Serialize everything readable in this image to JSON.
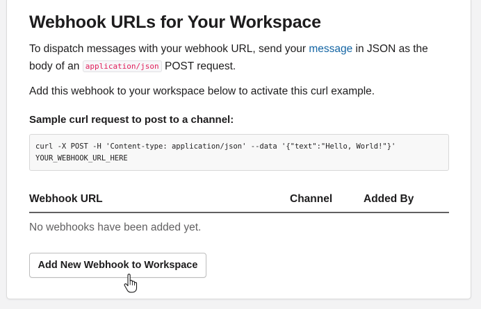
{
  "page": {
    "title": "Webhook URLs for Your Workspace",
    "intro": {
      "text_before_link": "To dispatch messages with your webhook URL, send your ",
      "link_text": "message",
      "text_after_link": " in JSON as the body of an ",
      "inline_code": "application/json",
      "text_end": " POST request."
    },
    "activate_note": "Add this webhook to your workspace below to activate this curl example.",
    "sample_label": "Sample curl request to post to a channel:",
    "sample_code": "curl -X POST -H 'Content-type: application/json' --data '{\"text\":\"Hello, World!\"}' YOUR_WEBHOOK_URL_HERE",
    "table": {
      "columns": [
        "Webhook URL",
        "Channel",
        "Added By"
      ],
      "empty_message": "No webhooks have been added yet."
    },
    "add_button_label": "Add New Webhook to Workspace"
  },
  "colors": {
    "link": "#1264a3",
    "inline_code_text": "#e01e5a",
    "text": "#1d1c1d",
    "muted_text": "#616061"
  },
  "icons": {
    "cursor": "hand-pointer-cursor-icon"
  }
}
